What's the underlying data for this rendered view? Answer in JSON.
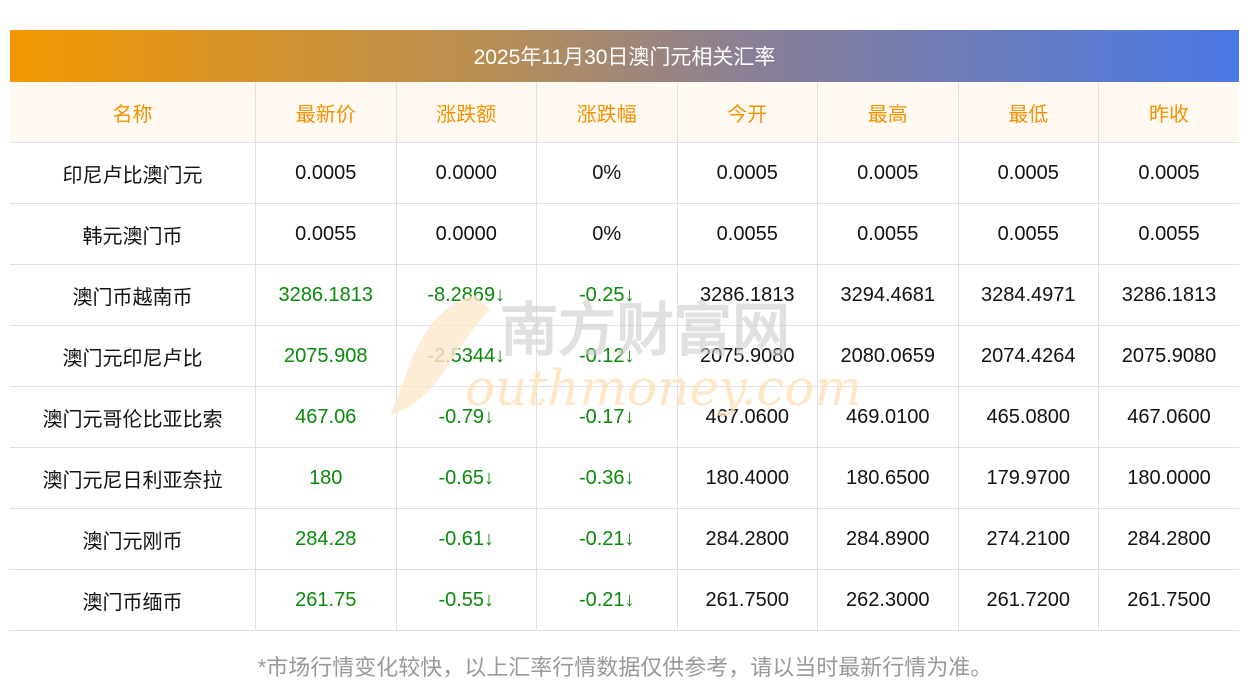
{
  "title": "2025年11月30日澳门元相关汇率",
  "columns": [
    "名称",
    "最新价",
    "涨跌额",
    "涨跌幅",
    "今开",
    "最高",
    "最低",
    "昨收"
  ],
  "rows": [
    {
      "name": "印尼卢比澳门元",
      "latest": "0.0005",
      "change": "0.0000",
      "pct": "0%",
      "open": "0.0005",
      "high": "0.0005",
      "low": "0.0005",
      "prev": "0.0005",
      "trend": "flat"
    },
    {
      "name": "韩元澳门币",
      "latest": "0.0055",
      "change": "0.0000",
      "pct": "0%",
      "open": "0.0055",
      "high": "0.0055",
      "low": "0.0055",
      "prev": "0.0055",
      "trend": "flat"
    },
    {
      "name": "澳门币越南币",
      "latest": "3286.1813",
      "change": "-8.2869↓",
      "pct": "-0.25↓",
      "open": "3286.1813",
      "high": "3294.4681",
      "low": "3284.4971",
      "prev": "3286.1813",
      "trend": "down"
    },
    {
      "name": "澳门元印尼卢比",
      "latest": "2075.908",
      "change": "-2.5344↓",
      "pct": "-0.12↓",
      "open": "2075.9080",
      "high": "2080.0659",
      "low": "2074.4264",
      "prev": "2075.9080",
      "trend": "down"
    },
    {
      "name": "澳门元哥伦比亚比索",
      "latest": "467.06",
      "change": "-0.79↓",
      "pct": "-0.17↓",
      "open": "467.0600",
      "high": "469.0100",
      "low": "465.0800",
      "prev": "467.0600",
      "trend": "down"
    },
    {
      "name": "澳门元尼日利亚奈拉",
      "latest": "180",
      "change": "-0.65↓",
      "pct": "-0.36↓",
      "open": "180.4000",
      "high": "180.6500",
      "low": "179.9700",
      "prev": "180.0000",
      "trend": "down"
    },
    {
      "name": "澳门元刚币",
      "latest": "284.28",
      "change": "-0.61↓",
      "pct": "-0.21↓",
      "open": "284.2800",
      "high": "284.8900",
      "low": "274.2100",
      "prev": "284.2800",
      "trend": "down"
    },
    {
      "name": "澳门币缅币",
      "latest": "261.75",
      "change": "-0.55↓",
      "pct": "-0.21↓",
      "open": "261.7500",
      "high": "262.3000",
      "low": "261.7200",
      "prev": "261.7500",
      "trend": "down"
    }
  ],
  "watermark": {
    "cn": "南方财富网",
    "en": "southmoney.com"
  },
  "colors": {
    "up_down_green": "#0a8a0a",
    "header_orange": "#f39200"
  },
  "footer": "*市场行情变化较快，以上汇率行情数据仅供参考，请以当时最新行情为准。"
}
